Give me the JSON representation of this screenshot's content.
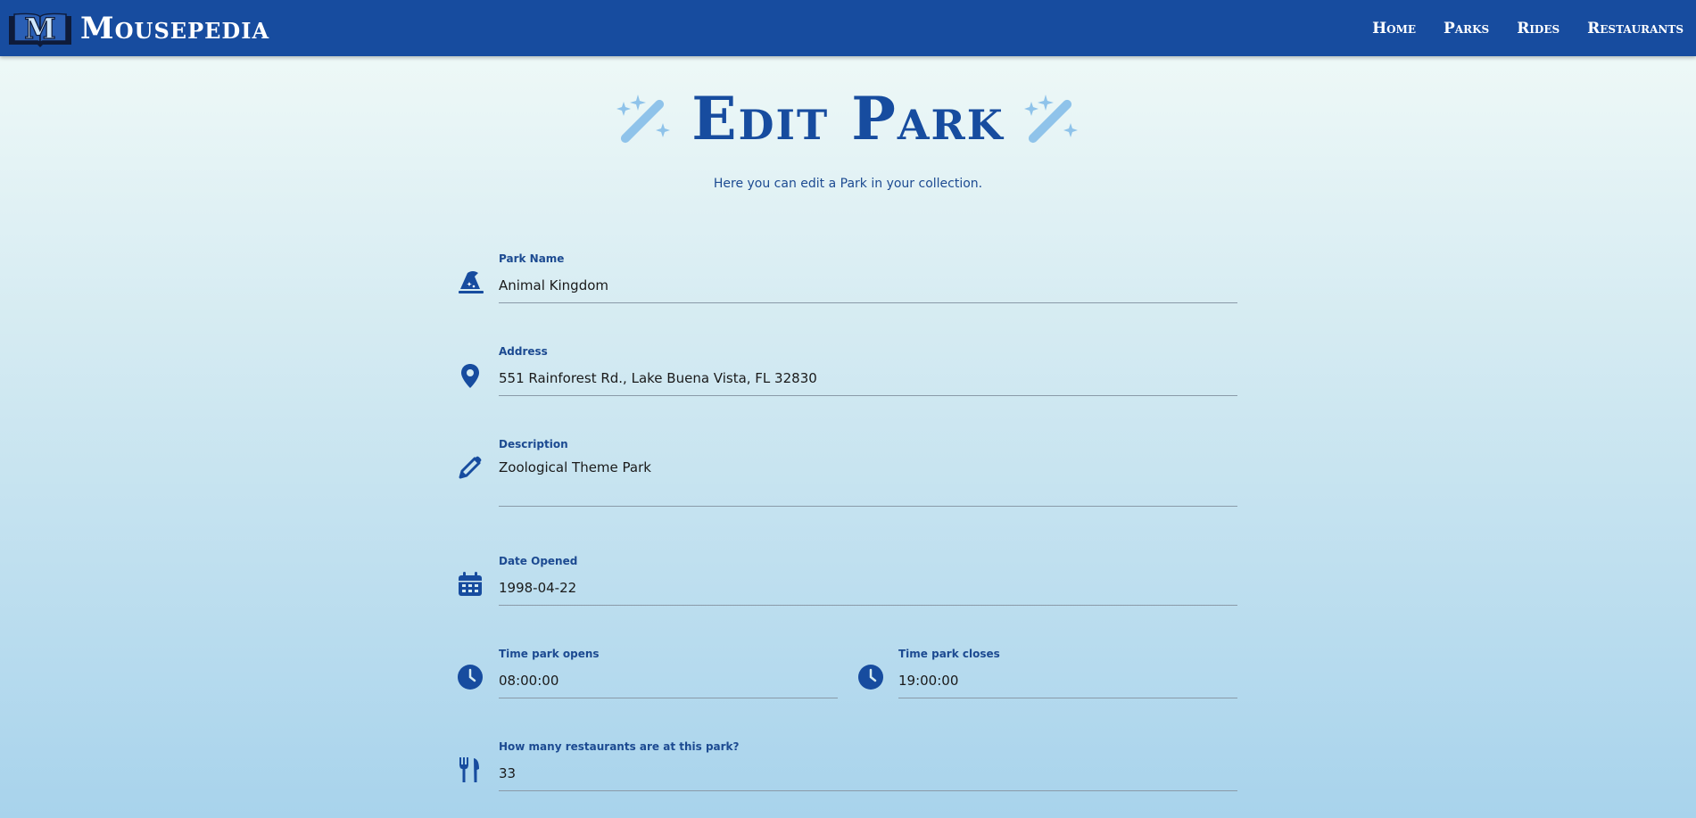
{
  "app": {
    "brand_name": "Mousepedia",
    "logo_letter": "M"
  },
  "nav": {
    "items": [
      {
        "label": "Home"
      },
      {
        "label": "Parks"
      },
      {
        "label": "Rides"
      },
      {
        "label": "Restaurants"
      }
    ]
  },
  "page": {
    "title": "Edit Park",
    "subtitle": "Here you can edit a Park in your collection."
  },
  "form": {
    "park_name": {
      "label": "Park Name",
      "value": "Animal Kingdom",
      "icon": "wizard-hat-icon"
    },
    "address": {
      "label": "Address",
      "value": "551 Rainforest Rd., Lake Buena Vista, FL 32830",
      "icon": "map-pin-icon"
    },
    "description": {
      "label": "Description",
      "value": "Zoological Theme Park",
      "icon": "pencil-icon"
    },
    "date_opened": {
      "label": "Date Opened",
      "value": "1998-04-22",
      "icon": "calendar-icon"
    },
    "time_opens": {
      "label": "Time park opens",
      "value": "08:00:00",
      "icon": "clock-icon"
    },
    "time_closes": {
      "label": "Time park closes",
      "value": "19:00:00",
      "icon": "clock-icon"
    },
    "restaurant_count": {
      "label": "How many restaurants are at this park?",
      "value": "33",
      "icon": "utensils-icon"
    }
  },
  "colors": {
    "nav_bg": "#174c9f",
    "accent": "#174c9f",
    "wand": "#8fc3ea",
    "page_gradient_top": "#f3fbf8",
    "page_gradient_bottom": "#a8d3ec"
  }
}
